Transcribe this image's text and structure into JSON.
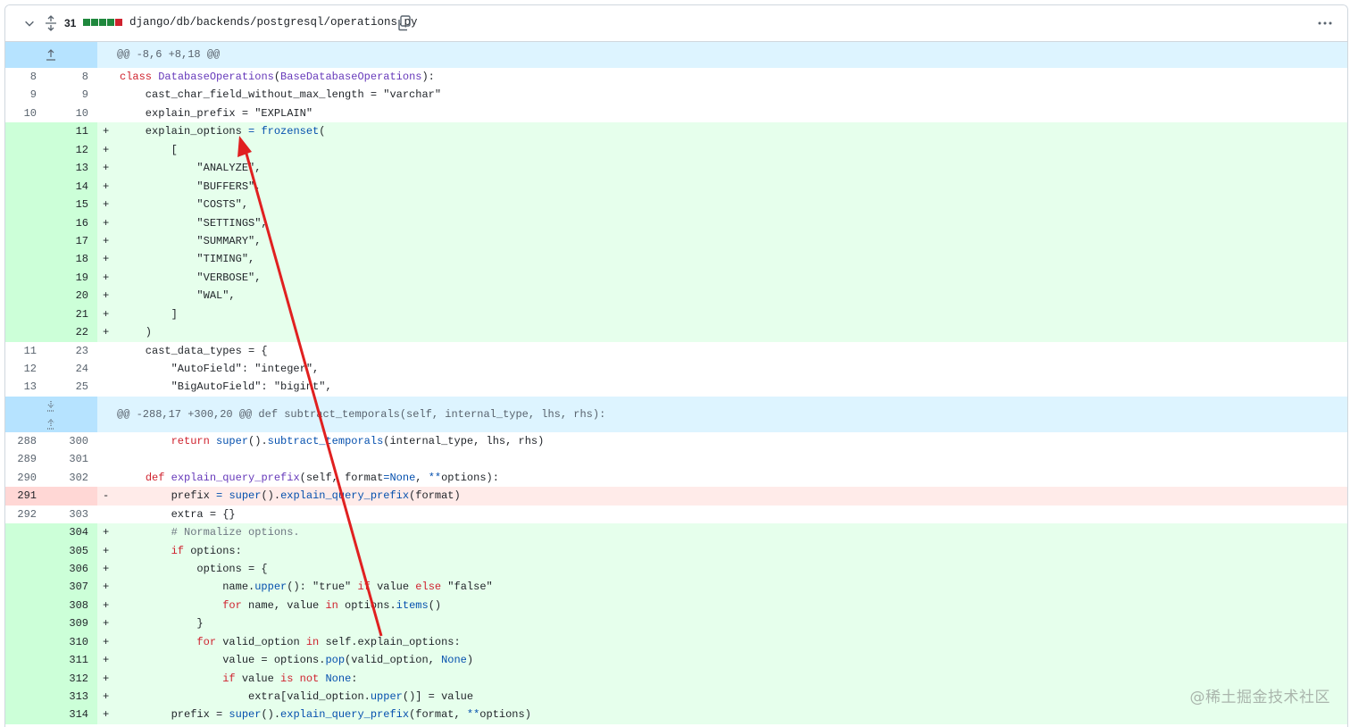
{
  "file": {
    "changes": "31",
    "path": "django/db/backends/postgresql/operations.py",
    "diffstat_colors": [
      "#1f883d",
      "#1f883d",
      "#1f883d",
      "#1f883d",
      "#cf222e"
    ]
  },
  "hunks": [
    "@@ -8,6 +8,18 @@",
    "@@ -288,17 +300,20 @@ def subtract_temporals(self, internal_type, lhs, rhs):"
  ],
  "lines": [
    {
      "o": "8",
      "n": "8",
      "m": "",
      "t": "ctx",
      "html": "<span class=\"kw\">class</span> <span class=\"fn\">DatabaseOperations</span>(<span class=\"fn\">BaseDatabaseOperations</span>):"
    },
    {
      "o": "9",
      "n": "9",
      "m": "",
      "t": "ctx",
      "text": "    cast_char_field_without_max_length = \"varchar\""
    },
    {
      "o": "10",
      "n": "10",
      "m": "",
      "t": "ctx",
      "text": "    explain_prefix = \"EXPLAIN\""
    },
    {
      "o": "",
      "n": "11",
      "m": "+",
      "t": "add",
      "html": "    explain_options <span class=\"bi\">=</span> <span class=\"bi\">frozenset</span>("
    },
    {
      "o": "",
      "n": "12",
      "m": "+",
      "t": "add",
      "text": "        ["
    },
    {
      "o": "",
      "n": "13",
      "m": "+",
      "t": "add",
      "text": "            \"ANALYZE\","
    },
    {
      "o": "",
      "n": "14",
      "m": "+",
      "t": "add",
      "text": "            \"BUFFERS\","
    },
    {
      "o": "",
      "n": "15",
      "m": "+",
      "t": "add",
      "text": "            \"COSTS\","
    },
    {
      "o": "",
      "n": "16",
      "m": "+",
      "t": "add",
      "text": "            \"SETTINGS\","
    },
    {
      "o": "",
      "n": "17",
      "m": "+",
      "t": "add",
      "text": "            \"SUMMARY\","
    },
    {
      "o": "",
      "n": "18",
      "m": "+",
      "t": "add",
      "text": "            \"TIMING\","
    },
    {
      "o": "",
      "n": "19",
      "m": "+",
      "t": "add",
      "text": "            \"VERBOSE\","
    },
    {
      "o": "",
      "n": "20",
      "m": "+",
      "t": "add",
      "text": "            \"WAL\","
    },
    {
      "o": "",
      "n": "21",
      "m": "+",
      "t": "add",
      "text": "        ]"
    },
    {
      "o": "",
      "n": "22",
      "m": "+",
      "t": "add",
      "text": "    )"
    },
    {
      "o": "11",
      "n": "23",
      "m": "",
      "t": "ctx",
      "text": "    cast_data_types = {"
    },
    {
      "o": "12",
      "n": "24",
      "m": "",
      "t": "ctx",
      "text": "        \"AutoField\": \"integer\","
    },
    {
      "o": "13",
      "n": "25",
      "m": "",
      "t": "ctx",
      "text": "        \"BigAutoField\": \"bigint\","
    },
    {
      "hunk": 1
    },
    {
      "o": "288",
      "n": "300",
      "m": "",
      "t": "ctx",
      "html": "        <span class=\"kw\">return</span> <span class=\"bi\">super</span>().<span class=\"bi\">subtract_temporals</span>(internal_type, lhs, rhs)"
    },
    {
      "o": "289",
      "n": "301",
      "m": "",
      "t": "ctx",
      "text": ""
    },
    {
      "o": "290",
      "n": "302",
      "m": "",
      "t": "ctx",
      "html": "    <span class=\"kw\">def</span> <span class=\"fn\">explain_query_prefix</span>(self, format<span class=\"bi\">=None</span>, <span class=\"bi\">**</span>options):"
    },
    {
      "o": "291",
      "n": "",
      "m": "-",
      "t": "del",
      "html": "        prefix <span class=\"bi\">=</span> <span class=\"bi\">super</span>().<span class=\"bi\">explain_query_prefix</span>(format)"
    },
    {
      "o": "292",
      "n": "303",
      "m": "",
      "t": "ctx",
      "text": "        extra = {}"
    },
    {
      "o": "",
      "n": "304",
      "m": "+",
      "t": "add",
      "html": "        <span class=\"cm\"># Normalize options.</span>"
    },
    {
      "o": "",
      "n": "305",
      "m": "+",
      "t": "add",
      "html": "        <span class=\"kw\">if</span> options:"
    },
    {
      "o": "",
      "n": "306",
      "m": "+",
      "t": "add",
      "text": "            options = {"
    },
    {
      "o": "",
      "n": "307",
      "m": "+",
      "t": "add",
      "html": "                name.<span class=\"bi\">upper</span>(): \"true\" <span class=\"kw\">if</span> value <span class=\"kw\">else</span> \"false\""
    },
    {
      "o": "",
      "n": "308",
      "m": "+",
      "t": "add",
      "html": "                <span class=\"kw\">for</span> name, value <span class=\"kw\">in</span> options.<span class=\"bi\">items</span>()"
    },
    {
      "o": "",
      "n": "309",
      "m": "+",
      "t": "add",
      "text": "            }"
    },
    {
      "o": "",
      "n": "310",
      "m": "+",
      "t": "add",
      "html": "            <span class=\"kw\">for</span> valid_option <span class=\"kw\">in</span> self.explain_options:"
    },
    {
      "o": "",
      "n": "311",
      "m": "+",
      "t": "add",
      "html": "                value = options.<span class=\"bi\">pop</span>(valid_option, <span class=\"bi\">None</span>)"
    },
    {
      "o": "",
      "n": "312",
      "m": "+",
      "t": "add",
      "html": "                <span class=\"kw\">if</span> value <span class=\"kw\">is not</span> <span class=\"bi\">None</span>:"
    },
    {
      "o": "",
      "n": "313",
      "m": "+",
      "t": "add",
      "html": "                    extra[valid_option.<span class=\"bi\">upper</span>()] = value"
    },
    {
      "o": "",
      "n": "314",
      "m": "+",
      "t": "add",
      "html": "        prefix = <span class=\"bi\">super</span>().<span class=\"bi\">explain_query_prefix</span>(format, <span class=\"bi\">**</span>options)"
    }
  ],
  "watermark": "@稀土掘金技术社区",
  "annotation_color": "#e02020"
}
